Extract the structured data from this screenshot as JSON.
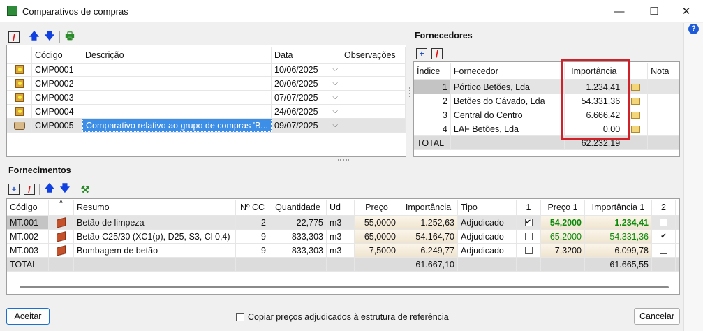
{
  "window": {
    "title": "Comparativos de compras",
    "minimize": "—",
    "maximize": "☐",
    "close": "✕",
    "help": "?"
  },
  "comparativos": {
    "columns": [
      "",
      "Código",
      "Descrição",
      "Data",
      "Observações"
    ],
    "rows": [
      {
        "icon": "certificate-icon",
        "codigo": "CMP0001",
        "descricao": "",
        "data": "10/06/2025",
        "obs": ""
      },
      {
        "icon": "certificate-icon",
        "codigo": "CMP0002",
        "descricao": "",
        "data": "20/06/2025",
        "obs": ""
      },
      {
        "icon": "certificate-icon",
        "codigo": "CMP0003",
        "descricao": "",
        "data": "07/07/2025",
        "obs": ""
      },
      {
        "icon": "certificate-icon",
        "codigo": "CMP0004",
        "descricao": "",
        "data": "24/06/2025",
        "obs": ""
      },
      {
        "icon": "open-box-icon",
        "codigo": "CMP0005",
        "descricao": "Comparativo relativo ao grupo de compras 'B...",
        "data": "09/07/2025",
        "obs": ""
      }
    ]
  },
  "fornecedores": {
    "title": "Fornecedores",
    "columns": [
      "Índice",
      "Fornecedor",
      "Importância",
      "",
      "Nota"
    ],
    "rows": [
      {
        "indice": "1",
        "nome": "Pórtico Betões, Lda",
        "importancia": "1.234,41"
      },
      {
        "indice": "2",
        "nome": "Betões do Cávado, Lda",
        "importancia": "54.331,36"
      },
      {
        "indice": "3",
        "nome": "Central do Centro",
        "importancia": "6.666,42"
      },
      {
        "indice": "4",
        "nome": "LAF Betões, Lda",
        "importancia": "0,00"
      }
    ],
    "total_label": "TOTAL",
    "total": "62.232,19",
    "highlight_color": "#d0202a"
  },
  "fornecimentos": {
    "title": "Fornecimentos",
    "sort_indicator": "^",
    "columns": [
      "Código",
      "",
      "Resumo",
      "Nº CC",
      "Quantidade",
      "Ud",
      "Preço",
      "Importância",
      "Tipo",
      "1",
      "Preço 1",
      "Importância 1",
      "2"
    ],
    "rows": [
      {
        "codigo": "MT.001",
        "resumo": "Betão de limpeza",
        "ncc": "2",
        "quant": "22,775",
        "ud": "m3",
        "preco": "55,0000",
        "imp": "1.252,63",
        "tipo": "Adjudicado",
        "c1": true,
        "preco1": "54,2000",
        "imp1": "1.234,41",
        "c2": false,
        "green": "bold"
      },
      {
        "codigo": "MT.002",
        "resumo": "Betão C25/30 (XC1(p), D25, S3, Cl 0,4)",
        "ncc": "9",
        "quant": "833,303",
        "ud": "m3",
        "preco": "65,0000",
        "imp": "54.164,70",
        "tipo": "Adjudicado",
        "c1": false,
        "preco1": "65,2000",
        "imp1": "54.331,36",
        "c2": true,
        "green": "normal"
      },
      {
        "codigo": "MT.003",
        "resumo": "Bombagem de betão",
        "ncc": "9",
        "quant": "833,303",
        "ud": "m3",
        "preco": "7,5000",
        "imp": "6.249,77",
        "tipo": "Adjudicado",
        "c1": false,
        "preco1": "7,3200",
        "imp1": "6.099,78",
        "c2": false,
        "green": "none"
      }
    ],
    "total_label": "TOTAL",
    "total_imp": "61.667,10",
    "total_imp1": "61.665,55"
  },
  "footer": {
    "accept": "Aceitar",
    "copy_label": "Copiar preços adjudicados à estrutura de referência",
    "copy_checked": false,
    "cancel": "Cancelar"
  }
}
